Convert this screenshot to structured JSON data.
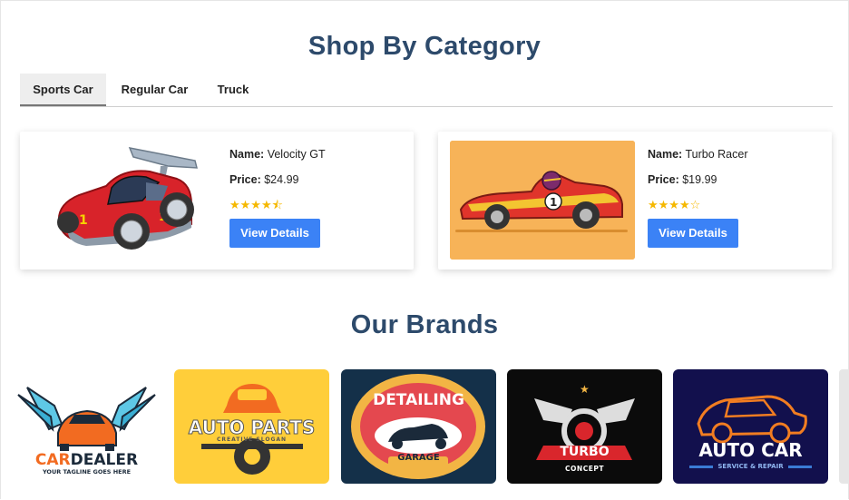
{
  "shop": {
    "title": "Shop By Category",
    "tabs": [
      {
        "label": "Sports Car",
        "active": true
      },
      {
        "label": "Regular Car",
        "active": false
      },
      {
        "label": "Truck",
        "active": false
      }
    ],
    "products": [
      {
        "name_label": "Name:",
        "name": "Velocity GT",
        "price_label": "Price:",
        "price": "$24.99",
        "rating": 4.5,
        "stars": "★★★★⯪",
        "button": "View Details"
      },
      {
        "name_label": "Name:",
        "name": "Turbo Racer",
        "price_label": "Price:",
        "price": "$19.99",
        "rating": 4,
        "stars": "★★★★☆",
        "button": "View Details"
      }
    ]
  },
  "brands": {
    "title": "Our Brands",
    "items": [
      {
        "name_a": "CAR",
        "name_b": "DEALER",
        "tagline": "YOUR TAGLINE GOES HERE"
      },
      {
        "name": "AUTO PARTS",
        "tagline": "CREATIVE SLOGAN"
      },
      {
        "name": "DETAILING",
        "tagline": "GARAGE"
      },
      {
        "name": "TURBO",
        "tagline": "CONCEPT"
      },
      {
        "name": "AUTO CAR",
        "tagline": "SERVICE & REPAIR"
      }
    ]
  },
  "colors": {
    "heading": "#2d4a6b",
    "button": "#3b82f6",
    "star": "#f5b800"
  }
}
